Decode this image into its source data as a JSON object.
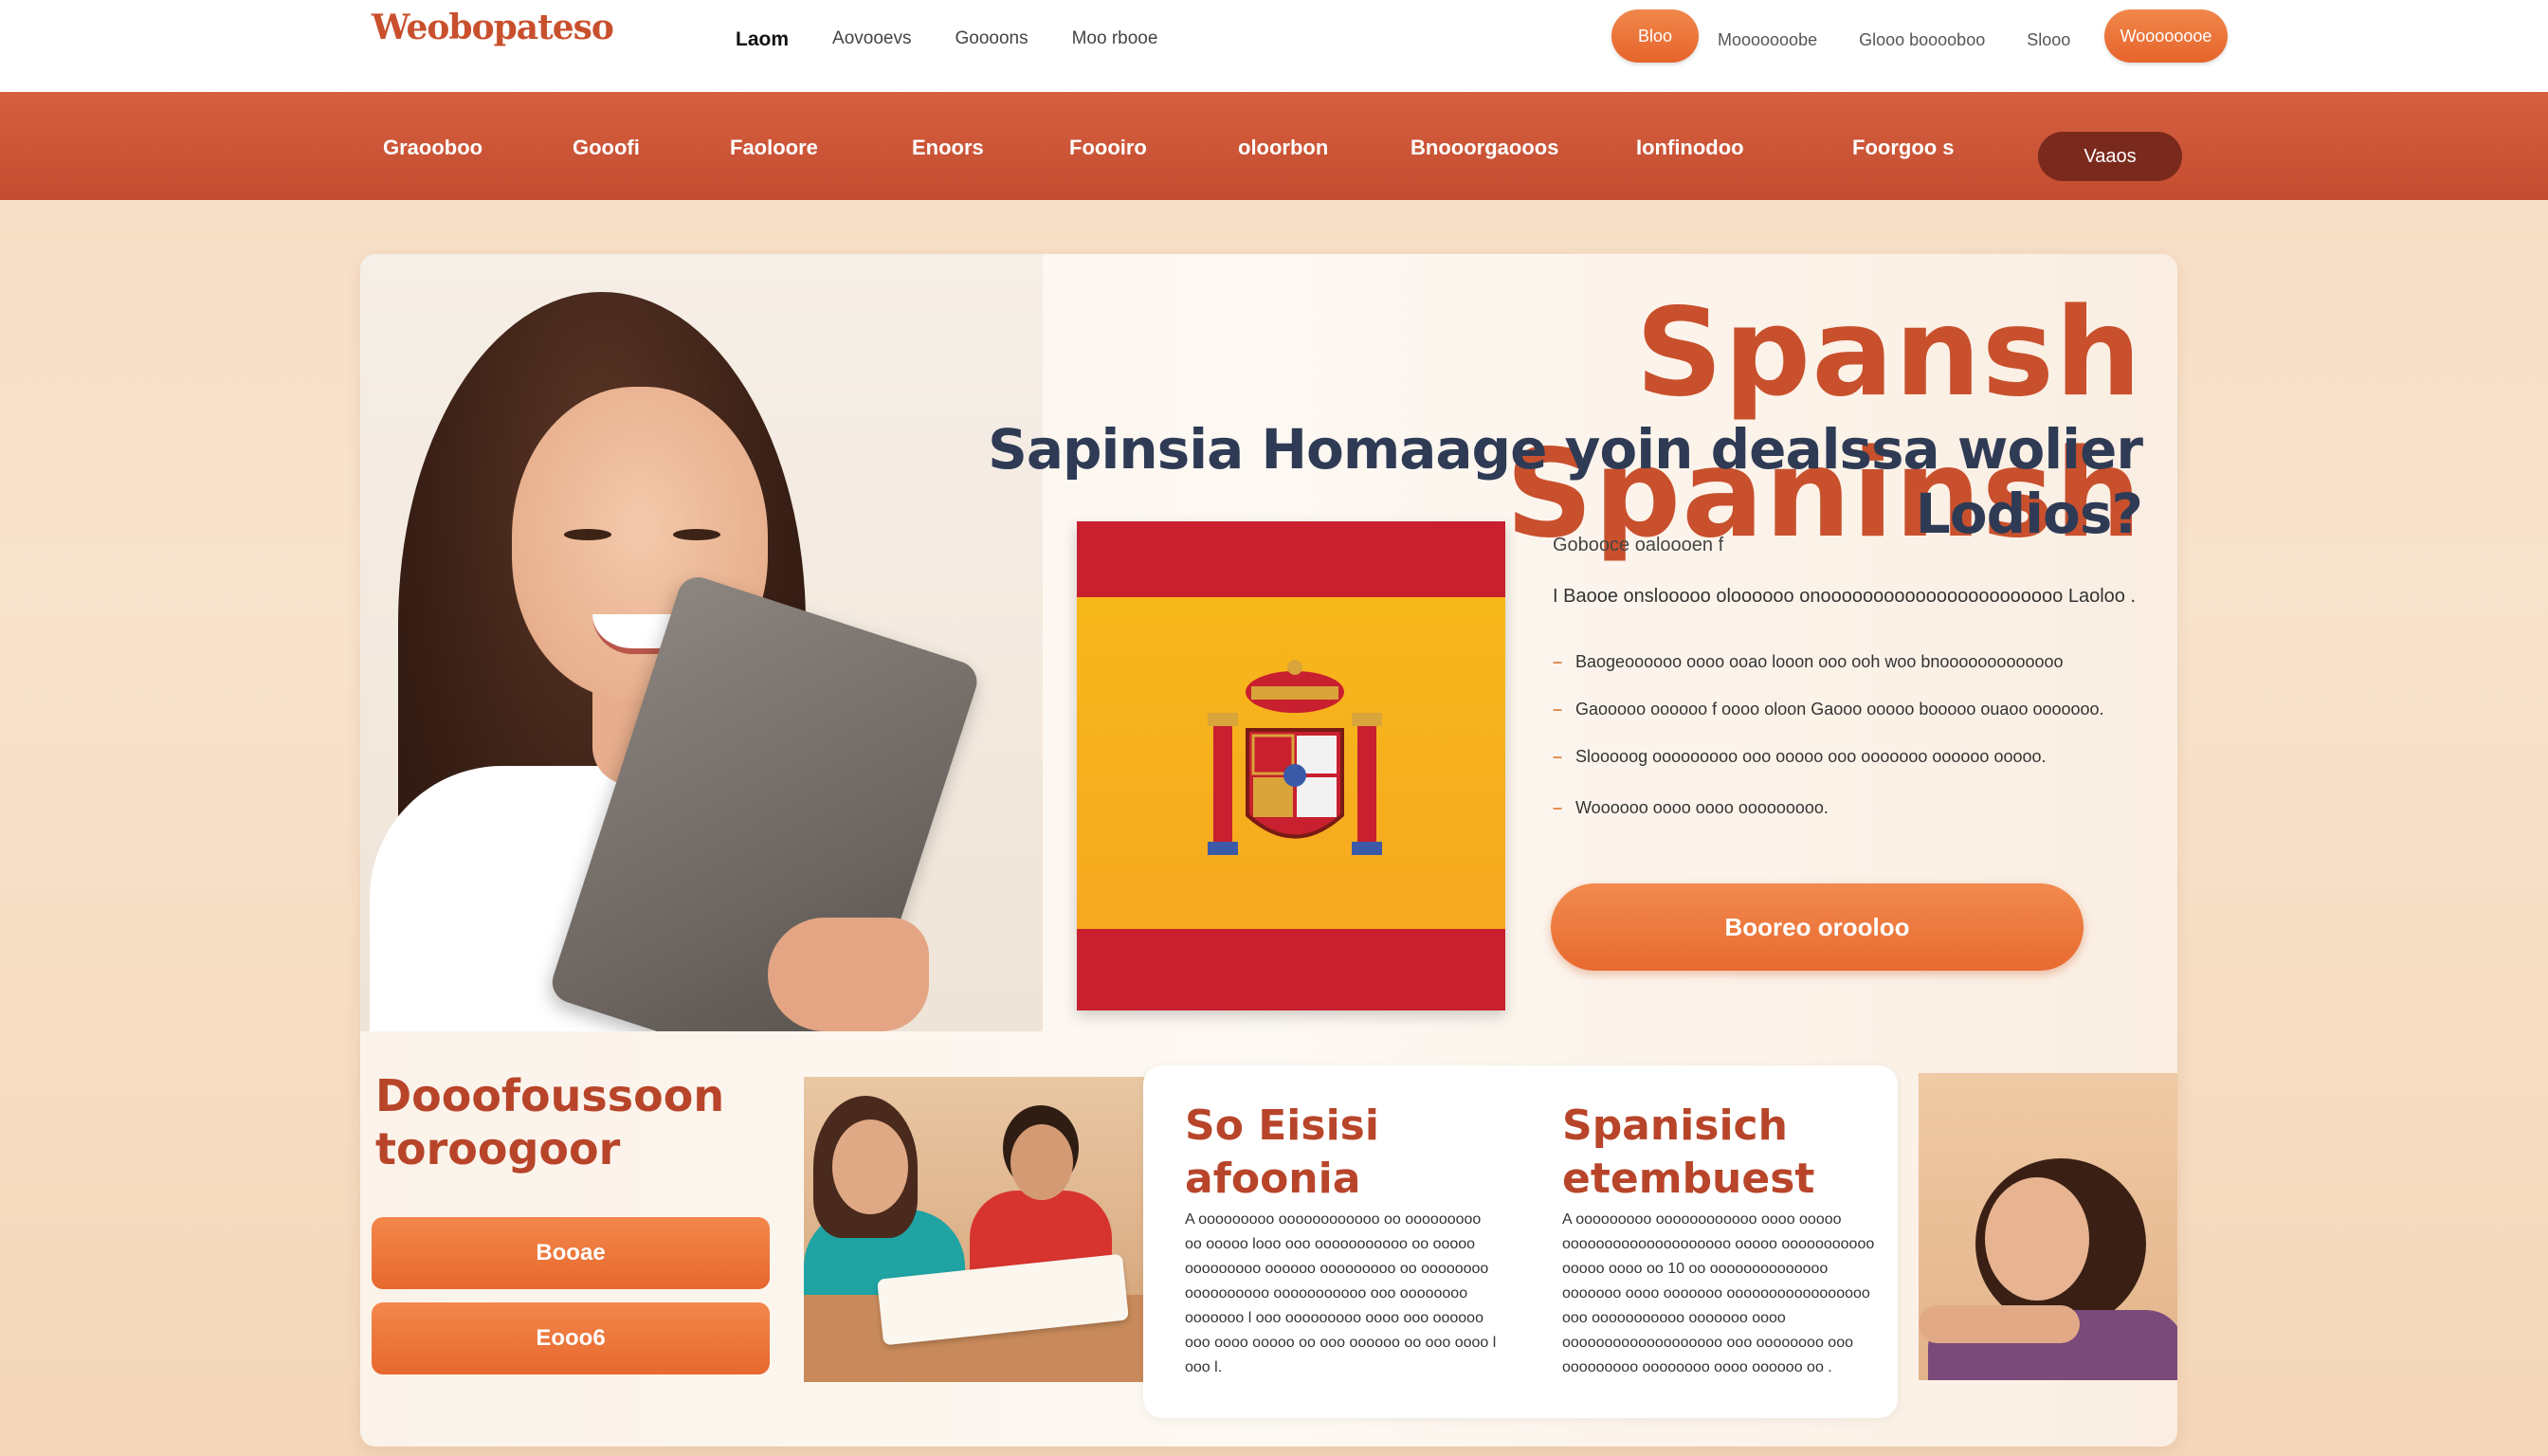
{
  "header": {
    "logo": "Weobopateso",
    "nav": [
      "Laom",
      "Aovooevs",
      "Goooons",
      "Moo rbooe"
    ],
    "nav_active_index": 0,
    "pill_small": "Bloo",
    "links": [
      "Mooooooobe",
      "Glooo booooboo",
      "Slooo"
    ],
    "pill_big": "Woooooooe"
  },
  "categories": {
    "items": [
      "Graooboo",
      "Gooofi",
      "Faoloore",
      "Enoors",
      "Foooiro",
      "oloorbon",
      "Bnooorgaooos",
      "Ionfinodoo",
      "Foorgoo s"
    ],
    "button": "Vaaos"
  },
  "hero": {
    "title": "Spansh Spaninsh",
    "subtitle": "Sapinsia Homaage yoin dealssa wolier Lodios?",
    "info_head": "Gobooce oaloooen f",
    "info_line": "I  Baooe onslooooo  oloooooo  onooooooooooooooooooooooo Laoloo .",
    "bullets": [
      "Baogeoooooo  oooo  ooao  looon  ooo  ooh  woo  bnooooooooooooo",
      "Gaooooo  oooooo  f oooo  oloon  Gaooo  ooooo  booooo  ouaoo  ooooooo.",
      "Slooooog  ooooooooo  ooo  ooooo  ooo  ooooooo  oooooo  ooooo.",
      "Woooooo  oooo  oooo  ooooooooo."
    ],
    "cta": "Booreo orooloo"
  },
  "bottom_left": {
    "title": "Dooofoussoon toroogoor",
    "button_a": "Booae",
    "button_b": "Eooo6"
  },
  "middle_card": {
    "col1_title": "So Eisisi afoonia",
    "col1_body": "A ooooooooo oooooooooooo  oo ooooooooo oo ooooo looo ooo ooooooooooo oo ooooo ooooooooo oooooo ooooooooo oo oooooooo oooooooooo ooooooooooo ooo oooooooo ooooooo l ooo ooooooooo oooo ooo oooooo ooo oooo ooooo oo ooo oooooo oo ooo oooo l ooo l.",
    "col2_title": "Spanisich etembuest",
    "col2_body": "A ooooooooo oooooooooooo oooo ooooo oooooooooooooooooooo ooooo ooooooooooo ooooo oooo oo 10 oo oooooooooooooo ooooooo oooo ooooooo ooooooooooooooooo ooo ooooooooooo ooooooo oooo ooooooooooooooooooo ooo oooooooo ooo ooooooooo oooooooo oooo oooooo oo ."
  },
  "colors": {
    "brand": "#c9502d",
    "accent": "#e86a30",
    "heading_dark": "#2f3b55",
    "category_bar": "#c44c30"
  }
}
